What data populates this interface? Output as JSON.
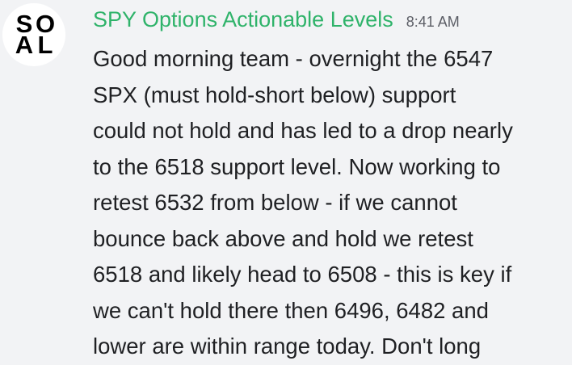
{
  "message": {
    "avatar_text": [
      "S",
      "O",
      "A",
      "L"
    ],
    "username": "SPY Options Actionable Levels",
    "timestamp": "8:41 AM",
    "lines": [
      "Good morning team - overnight the 6547",
      "SPX (must hold-short below) support",
      "could not hold and has led to a drop nearly",
      "to the 6518 support level.  Now working to",
      "retest 6532 from below - if we cannot",
      "bounce back above and hold we retest",
      "6518 and likely head to 6508 - this is key if",
      "we can't hold there then 6496, 6482 and",
      "lower are within range today. Don't long"
    ]
  },
  "colors": {
    "background": "#f2f3f5",
    "username": "#2fb36a",
    "timestamp": "#5c5e66",
    "text": "#1f2023"
  }
}
